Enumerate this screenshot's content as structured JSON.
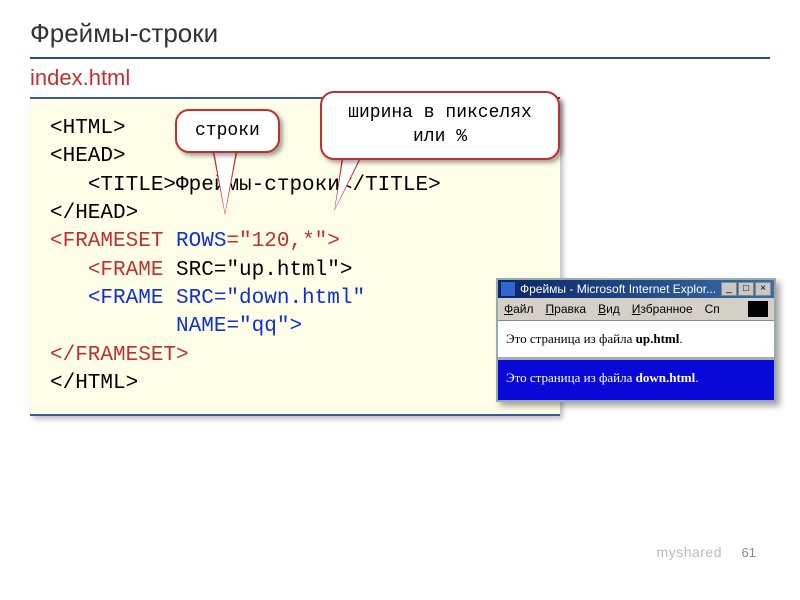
{
  "title": "Фреймы-строки",
  "filename": "index.html",
  "callouts": {
    "rows": "строки",
    "width": "ширина в пикселях или %"
  },
  "code": {
    "l1": "<HTML>",
    "l2": "<HEAD>",
    "l3a": "<TITLE>",
    "l3b": "Фреймы-строки",
    "l3c": "</TITLE>",
    "l4": "</HEAD>",
    "l5a": "<FRAMESET",
    "l5b": " ",
    "l5c": "ROWS",
    "l5d": "=\"120,*\">",
    "l6a": "<FRAME",
    "l6b": " SRC=\"up.html\">",
    "l7a": "<FRAME SRC=\"down.html\"",
    "l8a": "NAME=\"qq\">",
    "l9": "</FRAMESET>",
    "l10": "</HTML>"
  },
  "browser": {
    "title": "Фреймы - Microsoft Internet Explor...",
    "menu": {
      "file": "Файл",
      "edit": "Правка",
      "view": "Вид",
      "fav": "Избранное",
      "more": "Сп"
    },
    "up_a": "Это страница из файла ",
    "up_b": "up.html",
    "up_c": ".",
    "down_a": "Это страница из файла ",
    "down_b": "down.html",
    "down_c": "."
  },
  "pagenum": "61",
  "watermark": "myshared"
}
